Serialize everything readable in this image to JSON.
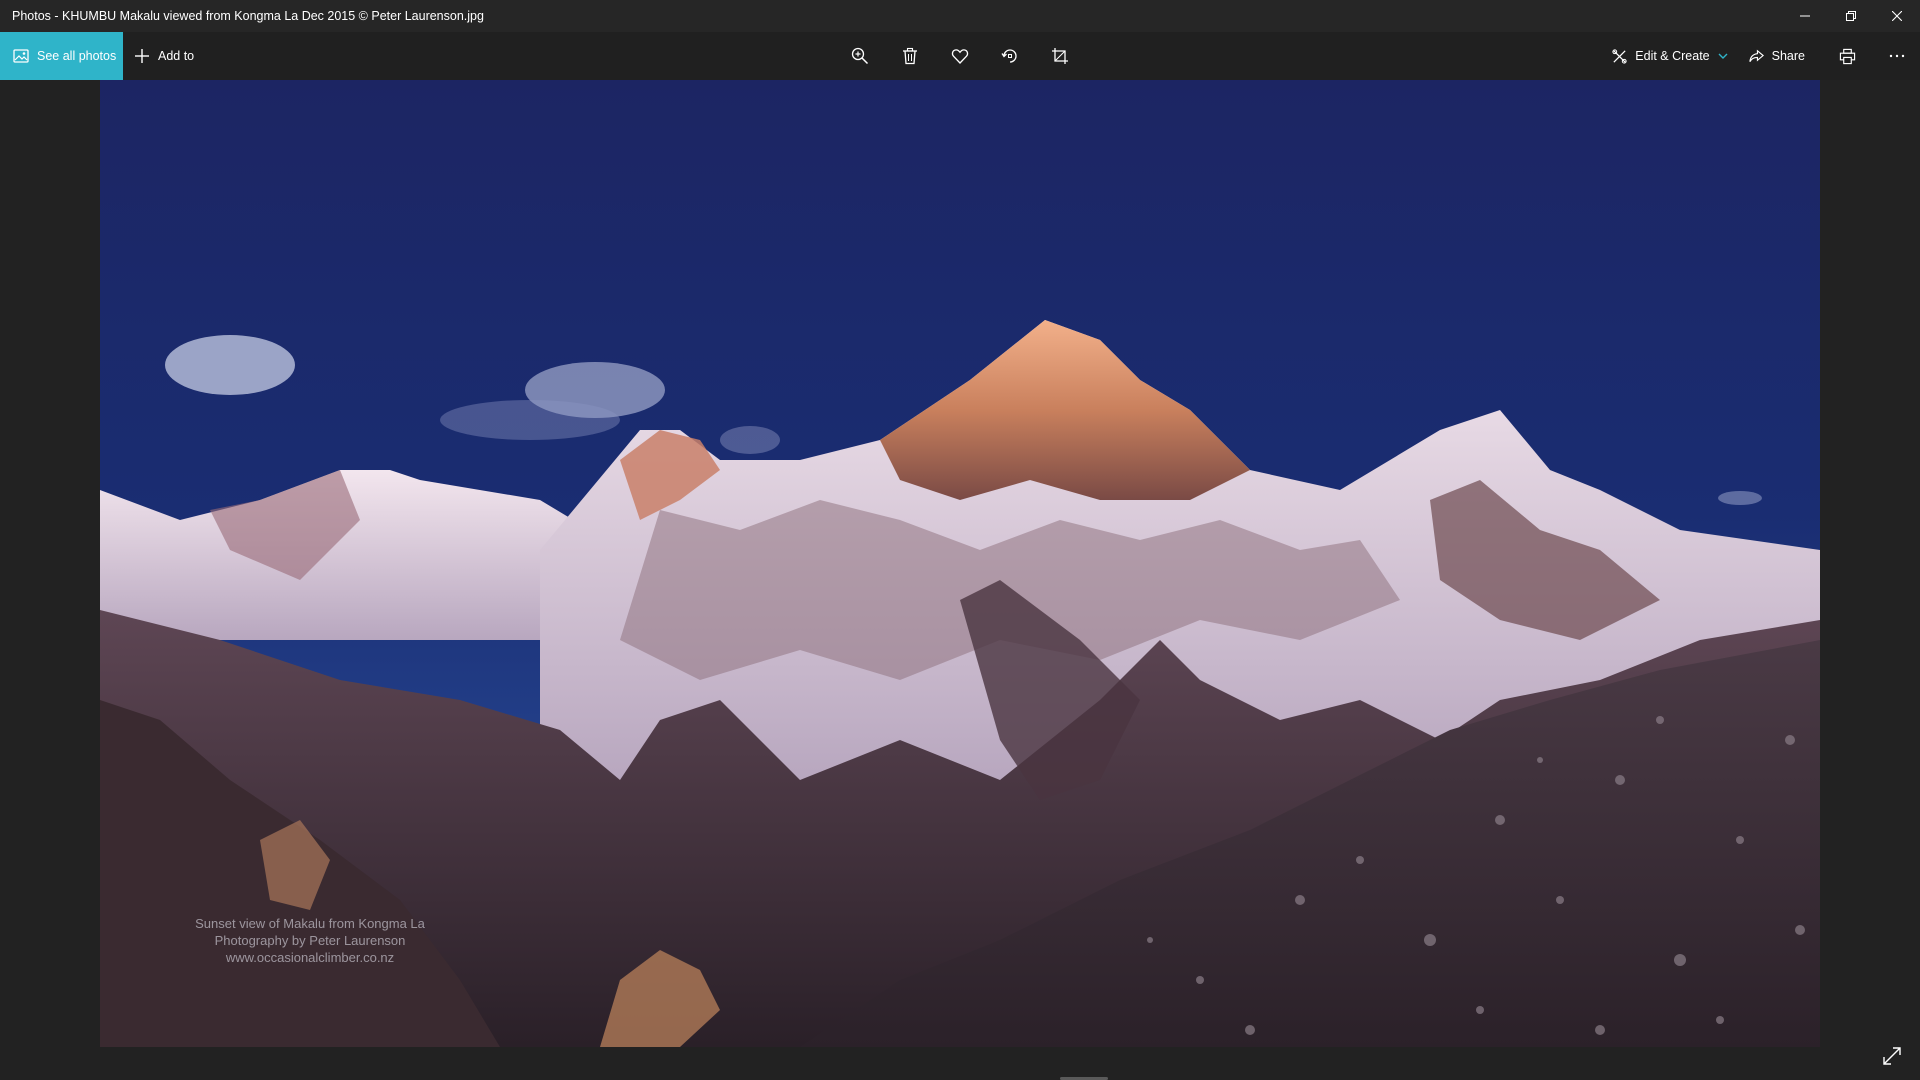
{
  "window": {
    "title": "Photos - KHUMBU Makalu viewed from Kongma La Dec 2015 © Peter Laurenson.jpg"
  },
  "toolbar": {
    "see_all_label": "See all photos",
    "add_to_label": "Add to",
    "edit_create_label": "Edit & Create",
    "share_label": "Share",
    "accent_color": "#2fb4c9"
  },
  "photo": {
    "watermark": [
      "Sunset view of Makalu from Kongma La",
      "Photography by Peter Laurenson",
      "www.occasionalclimber.co.nz"
    ]
  },
  "icons": {
    "see_all": "photos-icon",
    "add": "plus-icon",
    "zoom": "zoom-in-icon",
    "delete": "trash-icon",
    "favorite": "heart-icon",
    "rotate": "rotate-icon",
    "crop": "crop-icon",
    "edit": "edit-create-icon",
    "share": "share-icon",
    "print": "print-icon",
    "more": "more-icon",
    "expand": "expand-icon"
  }
}
